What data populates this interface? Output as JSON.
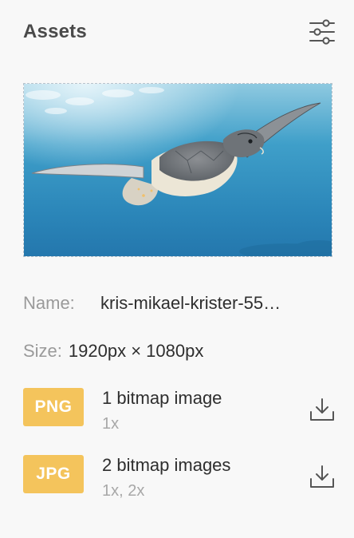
{
  "panel": {
    "title": "Assets",
    "settings_icon": "sliders-icon"
  },
  "preview": {
    "subject": "sea-turtle-underwater-photo"
  },
  "meta": {
    "name_label": "Name:",
    "name_value": "kris-mikael-krister-55…",
    "size_label": "Size:",
    "size_value": "1920px × 1080px"
  },
  "exports": [
    {
      "format": "PNG",
      "title": "1 bitmap image",
      "scales": "1x",
      "icon": "download-icon"
    },
    {
      "format": "JPG",
      "title": "2 bitmap images",
      "scales": "1x, 2x",
      "icon": "download-icon"
    }
  ],
  "colors": {
    "badge": "#f4c45c",
    "accent_text": "#4a4a4a",
    "muted_text": "#9a9a9a",
    "background": "#f8f8f8"
  }
}
